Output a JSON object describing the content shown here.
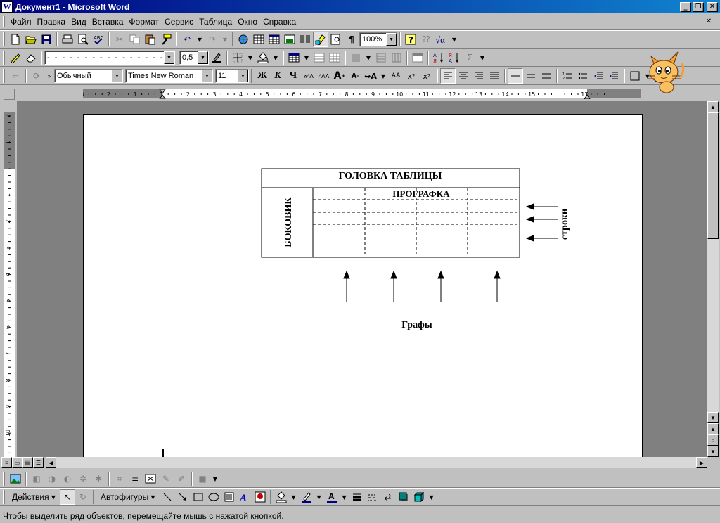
{
  "titlebar": {
    "title": "Документ1 - Microsoft Word",
    "icon": "W"
  },
  "menu": [
    "Файл",
    "Правка",
    "Вид",
    "Вставка",
    "Формат",
    "Сервис",
    "Таблица",
    "Окно",
    "Справка"
  ],
  "toolbar_standard": {
    "zoom": "100%"
  },
  "toolbar_tables": {
    "border_width": "0,5"
  },
  "toolbar_format": {
    "style": "Обычный",
    "font": "Times New Roman",
    "size": "11",
    "bold": "Ж",
    "italic": "К",
    "underline": "Ч"
  },
  "ruler": {
    "h_labels": [
      "3",
      "2",
      "1",
      "1",
      "2",
      "3",
      "4",
      "5",
      "6",
      "7",
      "8",
      "9",
      "10",
      "11",
      "12",
      "13",
      "14",
      "15",
      "17"
    ],
    "v_labels": [
      "2",
      "1",
      "1",
      "2",
      "3",
      "4",
      "5",
      "6",
      "7",
      "8",
      "9",
      "10"
    ]
  },
  "document": {
    "header": "ГОЛОВКА ТАБЛИЦЫ",
    "stub": "БОКОВИК",
    "prografka": "ПРОГРАФКА",
    "rows_label": "строки",
    "columns_label": "Графы"
  },
  "drawing": {
    "actions": "Действия",
    "autoshapes": "Автофигуры"
  },
  "status": {
    "text": "Чтобы выделить ряд объектов, перемещайте мышь с нажатой кнопкой."
  },
  "colors": {
    "title_start": "#000080",
    "title_end": "#1084d0",
    "face": "#c0c0c0",
    "workspace": "#808080"
  }
}
